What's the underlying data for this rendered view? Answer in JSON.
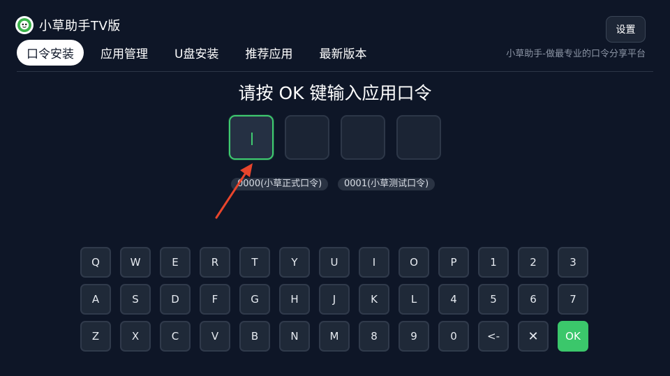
{
  "app": {
    "title": "小草助手TV版",
    "settings_label": "设置",
    "slogan": "小草助手-做最专业的口令分享平台"
  },
  "tabs": [
    {
      "label": "口令安装",
      "active": true
    },
    {
      "label": "应用管理",
      "active": false
    },
    {
      "label": "U盘安装",
      "active": false
    },
    {
      "label": "推荐应用",
      "active": false
    },
    {
      "label": "最新版本",
      "active": false
    }
  ],
  "entry": {
    "prompt": "请按 OK 键输入应用口令",
    "boxes": [
      "",
      "",
      "",
      ""
    ],
    "hints": [
      "0000(小草正式口令)",
      "0001(小草测试口令)"
    ]
  },
  "keyboard": {
    "rows": [
      [
        "Q",
        "W",
        "E",
        "R",
        "T",
        "Y",
        "U",
        "I",
        "O",
        "P",
        "1",
        "2",
        "3"
      ],
      [
        "A",
        "S",
        "D",
        "F",
        "G",
        "H",
        "J",
        "K",
        "L",
        "4",
        "5",
        "6",
        "7"
      ],
      [
        "Z",
        "X",
        "C",
        "V",
        "B",
        "N",
        "M",
        "8",
        "9",
        "0",
        "<-",
        "✕",
        "OK"
      ]
    ]
  },
  "colors": {
    "background": "#0e1627",
    "accent": "#3bc76b",
    "key_bg": "#1f2938",
    "annotation_arrow": "#e8452c"
  }
}
